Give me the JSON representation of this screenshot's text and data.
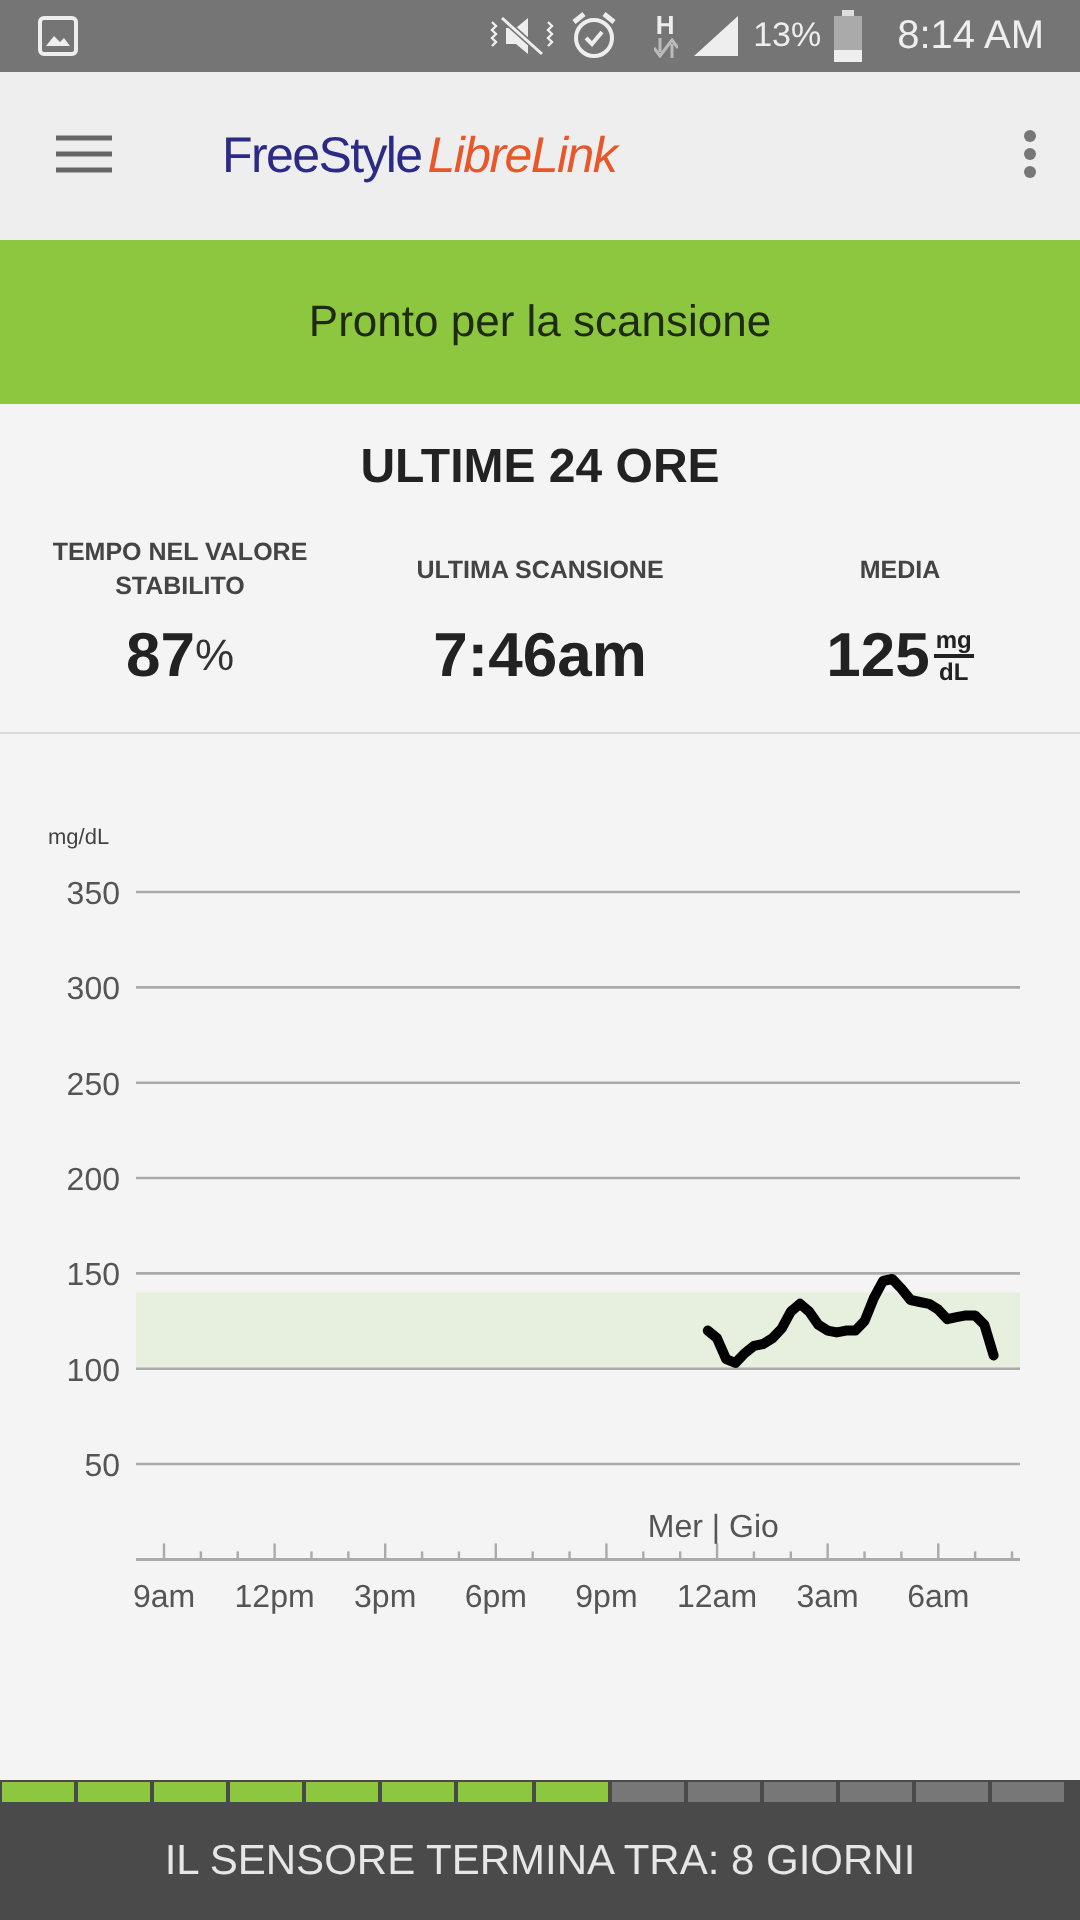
{
  "status_bar": {
    "network_type": "H",
    "battery": "13%",
    "time": "8:14 AM"
  },
  "app_bar": {
    "logo_primary": "FreeStyle",
    "logo_secondary": "LibreLink"
  },
  "banner": {
    "text": "Pronto per la scansione"
  },
  "summary": {
    "title": "ULTIME 24 ORE",
    "stats": [
      {
        "kind": "percent",
        "label": "TEMPO NEL VALORE STABILITO",
        "value": "87",
        "unit": "%"
      },
      {
        "kind": "plain",
        "label": "ULTIMA SCANSIONE",
        "value": "7:46am"
      },
      {
        "kind": "fraction",
        "label": "MEDIA",
        "value": "125",
        "unit_top": "mg",
        "unit_bottom": "dL"
      }
    ]
  },
  "chart": {
    "day_label": "Mer | Gio",
    "chart_data": {
      "type": "line",
      "ylabel": "mg/dL",
      "ylim": [
        0,
        350
      ],
      "grid": true,
      "categories": [
        "9am",
        null,
        null,
        null,
        null,
        null,
        null,
        null,
        null,
        null,
        null,
        null,
        "12pm",
        null,
        null,
        null,
        null,
        null,
        null,
        null,
        null,
        null,
        null,
        null,
        "3pm",
        null,
        null,
        null,
        null,
        null,
        null,
        null,
        null,
        null,
        null,
        null,
        "6pm",
        null,
        null,
        null,
        null,
        null,
        null,
        null,
        null,
        null,
        null,
        null,
        "9pm",
        null,
        null,
        null,
        null,
        null,
        null,
        null,
        null,
        null,
        null,
        null,
        "12am",
        null,
        null,
        null,
        null,
        null,
        null,
        null,
        null,
        null,
        null,
        null,
        "3am",
        null,
        null,
        null,
        null,
        null,
        null,
        null,
        null,
        null,
        null,
        null,
        "6am",
        null,
        null,
        null,
        null,
        null,
        null,
        null,
        null
      ],
      "series": [
        {
          "color": "#000000",
          "values": [
            null,
            null,
            null,
            null,
            null,
            null,
            null,
            null,
            null,
            null,
            null,
            null,
            null,
            null,
            null,
            null,
            null,
            null,
            null,
            null,
            null,
            null,
            null,
            null,
            null,
            null,
            null,
            null,
            null,
            null,
            null,
            null,
            null,
            null,
            null,
            null,
            null,
            null,
            null,
            null,
            null,
            null,
            null,
            null,
            null,
            null,
            null,
            null,
            null,
            null,
            null,
            null,
            null,
            null,
            null,
            null,
            null,
            null,
            null,
            120,
            116,
            105,
            103,
            108,
            112,
            113,
            116,
            121,
            130,
            134,
            130,
            123,
            120,
            119,
            120,
            120,
            125,
            137,
            146,
            147,
            142,
            136,
            135,
            134,
            131,
            126,
            127,
            128,
            128,
            123,
            107,
            null,
            null
          ]
        }
      ],
      "yticks": [
        50,
        100,
        150,
        200,
        250,
        300,
        350
      ],
      "bands": [
        {
          "axis": "y",
          "from": 100,
          "to": 140,
          "color": "#e7f0de"
        }
      ]
    }
  },
  "sensor": {
    "segments": [
      {
        "filled": true
      },
      {
        "filled": true
      },
      {
        "filled": true
      },
      {
        "filled": true
      },
      {
        "filled": true
      },
      {
        "filled": true
      },
      {
        "filled": true
      },
      {
        "filled": true
      },
      {
        "filled": false
      },
      {
        "filled": false
      },
      {
        "filled": false
      },
      {
        "filled": false
      },
      {
        "filled": false
      },
      {
        "filled": false
      }
    ],
    "message": "IL SENSORE TERMINA TRA: 8 GIORNI"
  }
}
